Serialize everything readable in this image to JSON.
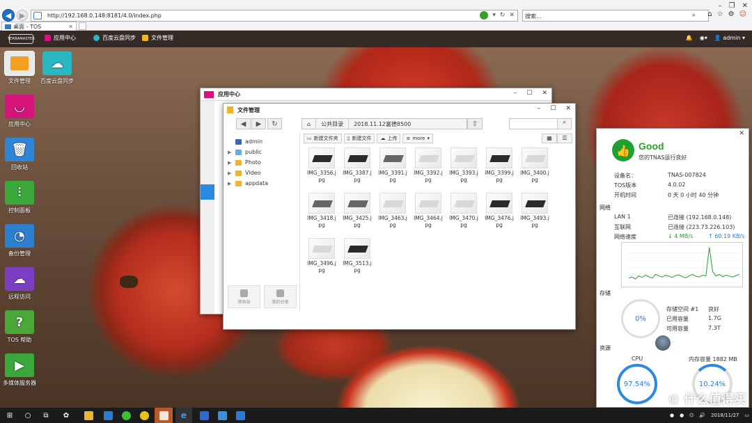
{
  "browser": {
    "url": "http://192.168.0.148:8181/4.0/index.php",
    "search_placeholder": "搜索...",
    "tab_title": "桌面 - TOS"
  },
  "tos_bar": {
    "logo_text": "TERRAMASTER",
    "tabs": [
      {
        "label": "应用中心",
        "icon": "app-center-icon",
        "color": "#d6137a"
      },
      {
        "label": "百度云盘同步",
        "icon": "baidu-cloud-icon",
        "color": "#2ab7c4"
      },
      {
        "label": "文件管理",
        "icon": "folder-icon",
        "color": "#f0b429"
      }
    ],
    "user": "admin"
  },
  "desktop": {
    "icons": [
      {
        "label": "文件管理",
        "icon": "folder-icon",
        "color": "#f3a020"
      },
      {
        "label": "百度云盘同步",
        "icon": "baidu-cloud-icon",
        "color": "#2ab7c4"
      },
      {
        "label": "应用中心",
        "icon": "app-center-icon",
        "color": "#d6137a"
      },
      {
        "label": "回收站",
        "icon": "recycle-bin-icon",
        "color": "#2f86d8"
      },
      {
        "label": "控制面板",
        "icon": "control-panel-icon",
        "color": "#3aa83a"
      },
      {
        "label": "备份管理",
        "icon": "backup-icon",
        "color": "#2f7fd1"
      },
      {
        "label": "远程访问",
        "icon": "remote-access-icon",
        "color": "#7b3fc5"
      },
      {
        "label": "TOS 帮助",
        "icon": "help-icon",
        "color": "#49a838"
      },
      {
        "label": "多媒体服务器",
        "icon": "media-server-icon",
        "color": "#3aa83a"
      }
    ]
  },
  "app_center_window": {
    "title": "应用中心"
  },
  "file_manager": {
    "title": "文件管理",
    "path": [
      "公共目录",
      "2018.11.12富德8500"
    ],
    "tree": [
      "admin",
      "public",
      "Photo",
      "Video",
      "appdata"
    ],
    "actions": [
      "新建文件夹",
      "新建文件",
      "上传",
      "more"
    ],
    "bottom_buttons": [
      "回收站",
      "我的分享"
    ],
    "files": [
      {
        "name": "IMG_3356.j",
        "ext": "pg",
        "tone": "dark"
      },
      {
        "name": "IMG_3387.j",
        "ext": "pg",
        "tone": "dark"
      },
      {
        "name": "IMG_3391.j",
        "ext": "pg",
        "tone": "mix"
      },
      {
        "name": "IMG_3392.j",
        "ext": "pg",
        "tone": "light"
      },
      {
        "name": "IMG_3393.j",
        "ext": "pg",
        "tone": "light"
      },
      {
        "name": "IMG_3399.j",
        "ext": "pg",
        "tone": "dark"
      },
      {
        "name": "IMG_3400.j",
        "ext": "pg",
        "tone": "light"
      },
      {
        "name": "IMG_3418.j",
        "ext": "pg",
        "tone": "mix"
      },
      {
        "name": "IMG_3425.j",
        "ext": "pg",
        "tone": "mix"
      },
      {
        "name": "IMG_3463.j",
        "ext": "pg",
        "tone": "light"
      },
      {
        "name": "IMG_3464.j",
        "ext": "pg",
        "tone": "light"
      },
      {
        "name": "IMG_3470.j",
        "ext": "pg",
        "tone": "light"
      },
      {
        "name": "IMG_3476.j",
        "ext": "pg",
        "tone": "dark"
      },
      {
        "name": "IMG_3493.j",
        "ext": "pg",
        "tone": "dark"
      },
      {
        "name": "IMG_3496.j",
        "ext": "pg",
        "tone": "light"
      },
      {
        "name": "IMG_3513.j",
        "ext": "pg",
        "tone": "dark"
      }
    ]
  },
  "monitor": {
    "status": "Good",
    "status_sub": "您的TNAS运行良好",
    "device_label": "设备名：",
    "device_value": "TNAS-007824",
    "tos_label": "TOS版本",
    "tos_value": "4.0.02",
    "uptime_label": "开机时间",
    "uptime_value": "0 天 0 小时 40 分钟",
    "network_title": "网络",
    "lan_label": "LAN 1",
    "lan_value": "已连接 (192.168.0.148)",
    "internet_label": "互联网",
    "internet_value": "已连接 (223.73.226.103)",
    "speed_label": "网络速度",
    "download": "↓ 4 MB/s",
    "upload": "↑ 60.19 KB/s",
    "storage_title": "存储",
    "storage_pct": "0%",
    "pool_label": "存储空间 #1",
    "pool_value": "良好",
    "used_label": "已用容量",
    "used_value": "1.7G",
    "avail_label": "可用容量",
    "avail_value": "7.3T",
    "resource_title": "资源",
    "cpu_label": "CPU",
    "cpu_pct": "97.54%",
    "mem_label": "内存容量 1882 MB",
    "mem_pct": "10.24%"
  },
  "taskbar": {
    "date": "2018/11/27",
    "watermark": "什么值得买"
  },
  "chart_data": {
    "type": "line",
    "title": "",
    "series": [
      {
        "values": [
          0.12,
          0.15,
          0.1,
          0.18,
          0.14,
          0.2,
          0.16,
          0.12,
          0.22,
          0.18,
          0.15,
          0.2,
          0.17,
          0.14,
          0.19,
          0.21,
          0.16,
          0.13,
          0.18,
          0.22,
          0.17,
          0.15,
          0.2,
          0.18,
          0.95,
          0.3,
          0.18,
          0.22,
          0.16,
          0.2,
          0.17,
          0.15,
          0.19,
          0.22
        ]
      }
    ],
    "grid": true
  }
}
